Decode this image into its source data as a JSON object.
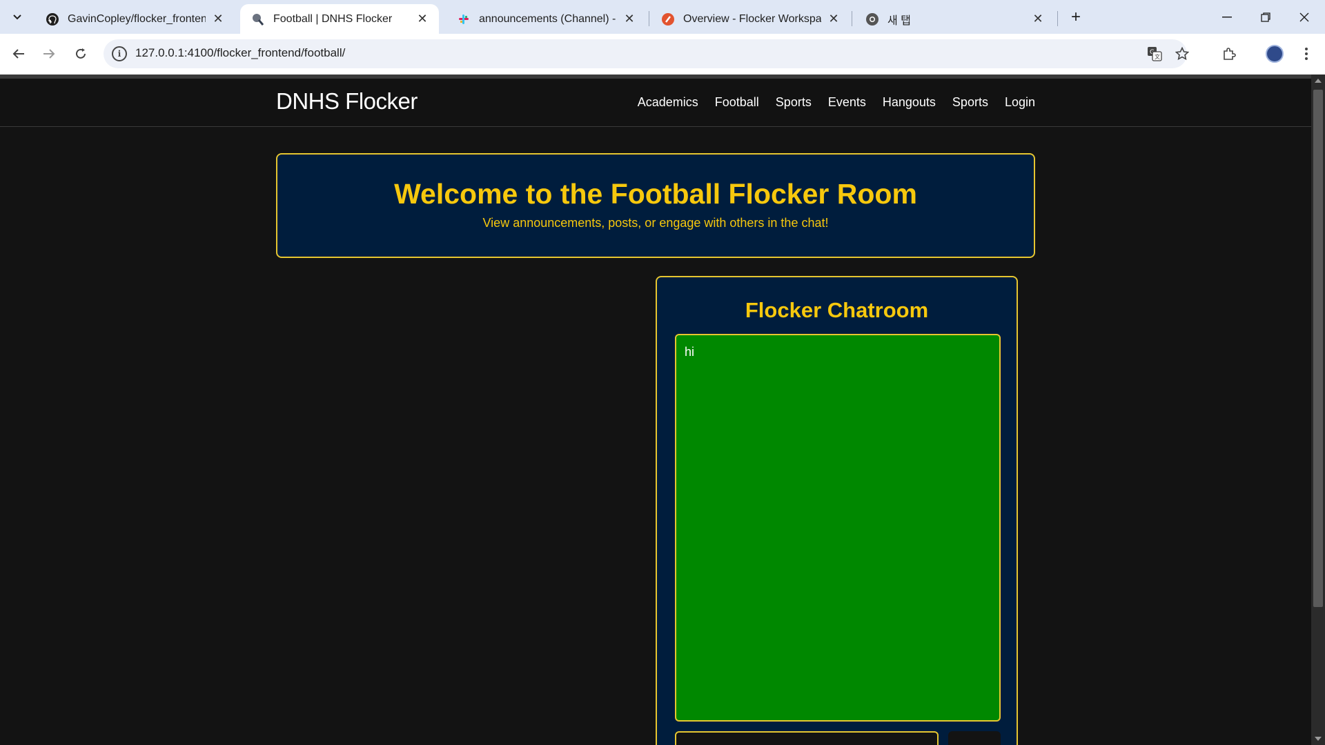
{
  "browser": {
    "tabs": [
      {
        "title": "GavinCopley/flocker_frontend: F",
        "icon": "github-icon"
      },
      {
        "title": "Football | DNHS Flocker",
        "icon": "flocker-icon",
        "active": true
      },
      {
        "title": "announcements (Channel) - CS",
        "icon": "slack-icon"
      },
      {
        "title": "Overview - Flocker Workspace",
        "icon": "workspace-icon"
      },
      {
        "title": "새 탭",
        "icon": "chrome-icon"
      }
    ],
    "url": "127.0.0.1:4100/flocker_frontend/football/"
  },
  "site": {
    "brand": "DNHS Flocker",
    "nav": [
      "Academics",
      "Football",
      "Sports",
      "Events",
      "Hangouts",
      "Sports",
      "Login"
    ]
  },
  "hero": {
    "title": "Welcome to the Football Flocker Room",
    "subtitle": "View announcements, posts, or engage with others in the chat!"
  },
  "chat": {
    "title": "Flocker Chatroom",
    "messages": [
      "hi"
    ],
    "input_value": ""
  },
  "colors": {
    "accent": "#f7c80d",
    "panel": "#001d3d",
    "chat_bg": "#008800",
    "page_bg": "#131313"
  }
}
